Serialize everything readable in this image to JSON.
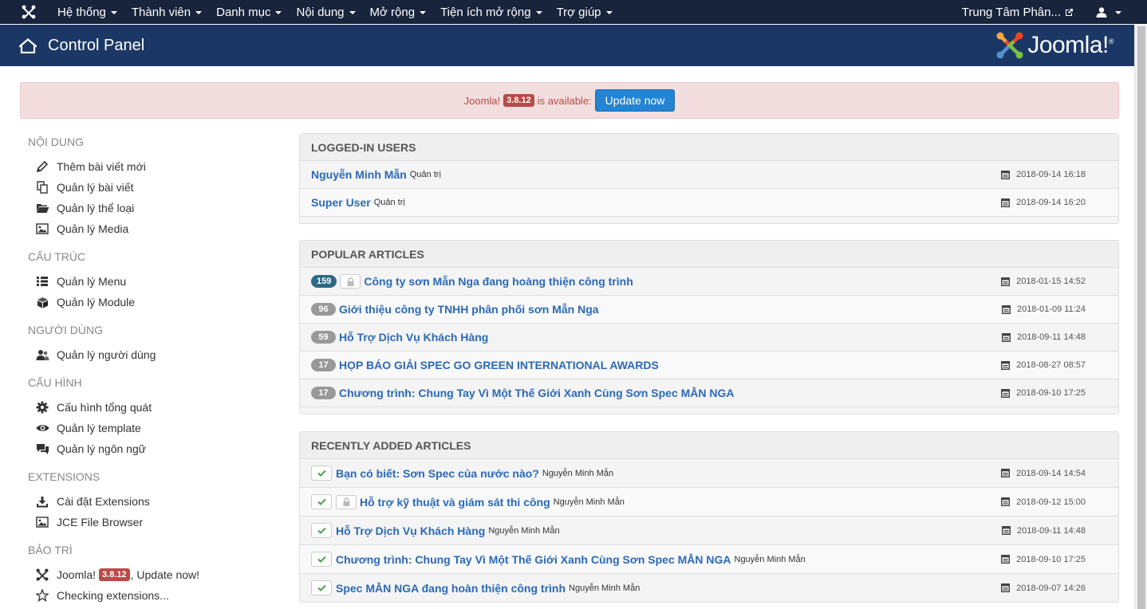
{
  "topnav": {
    "menu": [
      {
        "label": "Hệ thống"
      },
      {
        "label": "Thành viên"
      },
      {
        "label": "Danh mục"
      },
      {
        "label": "Nội dung"
      },
      {
        "label": "Mở rộng"
      },
      {
        "label": "Tiện ích mở rộng"
      },
      {
        "label": "Trợ giúp"
      }
    ],
    "site_name": "Trung Tâm Phân..."
  },
  "header": {
    "title": "Control Panel",
    "brand": "Joomla!",
    "brand_mark": "®"
  },
  "alert": {
    "prefix": "Joomla!",
    "version": "3.8.12",
    "suffix": "is available:",
    "button": "Update now"
  },
  "sidebar": {
    "sections": [
      {
        "heading": "NỘI DUNG",
        "items": [
          {
            "label": "Thêm bài viết mới",
            "icon": "pencil-icon"
          },
          {
            "label": "Quản lý bài viết",
            "icon": "copy-icon"
          },
          {
            "label": "Quản lý thể loại",
            "icon": "folder-icon"
          },
          {
            "label": "Quản lý Media",
            "icon": "image-icon"
          }
        ]
      },
      {
        "heading": "CẤU TRÚC",
        "items": [
          {
            "label": "Quản lý Menu",
            "icon": "list-icon"
          },
          {
            "label": "Quản lý Module",
            "icon": "cube-icon"
          }
        ]
      },
      {
        "heading": "NGƯỜI DÙNG",
        "items": [
          {
            "label": "Quản lý người dùng",
            "icon": "users-icon"
          }
        ]
      },
      {
        "heading": "CẤU HÌNH",
        "items": [
          {
            "label": "Cấu hình tổng quát",
            "icon": "cog-icon"
          },
          {
            "label": "Quản lý template",
            "icon": "eye-icon"
          },
          {
            "label": "Quản lý ngôn ngữ",
            "icon": "comments-icon"
          }
        ]
      },
      {
        "heading": "EXTENSIONS",
        "items": [
          {
            "label": "Cài đặt Extensions",
            "icon": "download-icon"
          },
          {
            "label": "JCE File Browser",
            "icon": "image-icon"
          }
        ]
      },
      {
        "heading": "BẢO TRÌ",
        "items": [
          {
            "label_prefix": "Joomla!",
            "badge": "3.8.12",
            "label_suffix": ", Update now!",
            "icon": "joomla-icon"
          },
          {
            "label": "Checking extensions...",
            "icon": "star-icon"
          }
        ]
      }
    ]
  },
  "logged_in": {
    "title": "LOGGED-IN USERS",
    "rows": [
      {
        "name": "Nguyễn Minh Mẫn",
        "role": "Quản trị",
        "date": "2018-09-14 16:18"
      },
      {
        "name": "Super User",
        "role": "Quản trị",
        "date": "2018-09-14 16:20"
      }
    ]
  },
  "popular": {
    "title": "POPULAR ARTICLES",
    "rows": [
      {
        "hits": "159",
        "locked": true,
        "title": "Công ty sơn Mẫn Nga đang hoàng thiện công trình",
        "date": "2018-01-15 14:52"
      },
      {
        "hits": "96",
        "locked": false,
        "title": "Giới thiệu công ty TNHH phân phối sơn Mẫn Nga",
        "date": "2018-01-09 11:24"
      },
      {
        "hits": "59",
        "locked": false,
        "title": "Hỗ Trợ Dịch Vụ Khách Hàng",
        "date": "2018-09-11 14:48"
      },
      {
        "hits": "17",
        "locked": false,
        "title": "HỌP BÁO GIẢI SPEC GO GREEN INTERNATIONAL AWARDS",
        "date": "2018-08-27 08:57"
      },
      {
        "hits": "17",
        "locked": false,
        "title": "Chương trình: Chung Tay Vì Một Thế Giới Xanh Cùng Sơn Spec MẪN NGA",
        "date": "2018-09-10 17:25"
      }
    ]
  },
  "recent": {
    "title": "RECENTLY ADDED ARTICLES",
    "rows": [
      {
        "locked": false,
        "title": "Bạn có biết: Sơn Spec của nước nào?",
        "author": "Nguyễn Minh Mẫn",
        "date": "2018-09-14 14:54"
      },
      {
        "locked": true,
        "title": "Hỗ trợ kỹ thuật và giám sát thi công",
        "author": "Nguyễn Minh Mẫn",
        "date": "2018-09-12 15:00"
      },
      {
        "locked": false,
        "title": "Hỗ Trợ Dịch Vụ Khách Hàng",
        "author": "Nguyễn Minh Mẫn",
        "date": "2018-09-11 14:48"
      },
      {
        "locked": false,
        "title": "Chương trình: Chung Tay Vì Một Thế Giới Xanh Cùng Sơn Spec MẪN NGA",
        "author": "Nguyễn Minh Mẫn",
        "date": "2018-09-10 17:25"
      },
      {
        "locked": false,
        "title": "Spec MẪN NGA đang hoàn thiện công trình",
        "author": "Nguyễn Minh Mẫn",
        "date": "2018-09-07 14:26"
      }
    ]
  },
  "colors": {
    "topnav_bg": "#17243b",
    "header_bg": "#1b3765",
    "link": "#2a69b8",
    "alert_bg": "#f2dede",
    "alert_text": "#b94a48",
    "button": "#2384d3",
    "hits_hot": "#2d6987"
  }
}
